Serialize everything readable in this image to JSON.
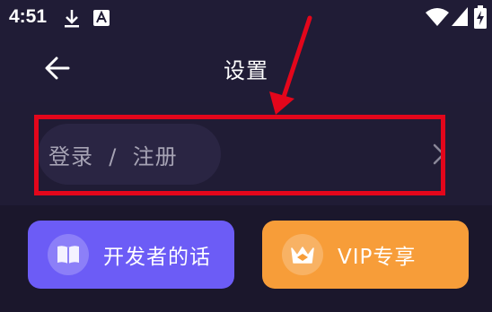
{
  "status_bar": {
    "time": "4:51",
    "left_icons": [
      "download-icon",
      "keyboard-a-icon"
    ],
    "right_icons": [
      "wifi-icon",
      "cellular-signal-icon",
      "battery-charging-icon"
    ]
  },
  "header": {
    "title": "设置",
    "back_icon": "arrow-left-icon"
  },
  "login_row": {
    "label": "登录  /  注册",
    "chevron_icon": "chevron-right-icon"
  },
  "annotation": {
    "color": "#e3061b",
    "type": "red-arrow-and-box"
  },
  "cards": {
    "developer": {
      "label": "开发者的话",
      "icon": "book-icon",
      "color": "#6c5cf6"
    },
    "vip": {
      "label": "VIP专享",
      "icon": "crown-icon",
      "color": "#f79d39"
    }
  }
}
